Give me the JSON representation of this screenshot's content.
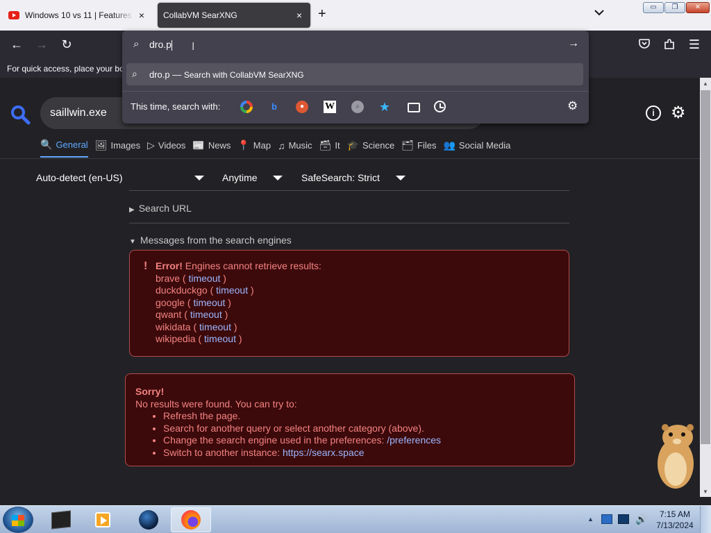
{
  "browser": {
    "tabs": [
      {
        "title": "Windows 10 vs 11 | Features & More",
        "active": false
      },
      {
        "title": "CollabVM SearXNG",
        "active": true
      }
    ],
    "new_tab_icon": "+",
    "tab_close_icon": "×",
    "tab_list_icon": "chevron-down-icon",
    "toolbar": {
      "back_icon": "←",
      "forward_icon": "→",
      "reload_icon": "↻",
      "pocket_icon": "pocket-icon",
      "extensions_icon": "puzzle-icon",
      "menu_icon": "☰"
    },
    "bookmarks_bar_text": "For quick access, place your bookmarks here on the bookmarks toolbar."
  },
  "urlbar": {
    "value": "dro.p",
    "suggestion": {
      "query": "dro.p",
      "separator": " — ",
      "description": "Search with CollabVM SearXNG"
    },
    "one_off_label": "This time, search with:",
    "engines": [
      "google-icon",
      "bing-icon",
      "duckduckgo-icon",
      "wikipedia-icon",
      "searx-icon",
      "bookmarks-star-icon",
      "tabs-icon",
      "history-icon"
    ],
    "wiki_glyph": "W",
    "settings_icon": "⚙",
    "go_icon": "→",
    "search_glyph": "⌕"
  },
  "page": {
    "query": "saillwin.exe",
    "info_icon": "i",
    "prefs_icon": "⚙",
    "categories": [
      {
        "label": "General",
        "icon": "🔍",
        "active": true
      },
      {
        "label": "Images",
        "icon": "🖼",
        "active": false
      },
      {
        "label": "Videos",
        "icon": "▷",
        "active": false
      },
      {
        "label": "News",
        "icon": "📰",
        "active": false
      },
      {
        "label": "Map",
        "icon": "📍",
        "active": false
      },
      {
        "label": "Music",
        "icon": "♫",
        "active": false
      },
      {
        "label": "It",
        "icon": "🗃",
        "active": false
      },
      {
        "label": "Science",
        "icon": "🎓",
        "active": false
      },
      {
        "label": "Files",
        "icon": "🗂",
        "active": false
      },
      {
        "label": "Social Media",
        "icon": "👥",
        "active": false
      }
    ],
    "filters": {
      "language": "Auto-detect (en-US)",
      "time": "Anytime",
      "safesearch": "SafeSearch: Strict"
    },
    "search_url_label": "Search URL",
    "messages_label": "Messages from the search engines",
    "error": {
      "bang": "!",
      "title": "Error!",
      "text": "Engines cannot retrieve results:",
      "engines": [
        {
          "name": "brave",
          "reason": "timeout"
        },
        {
          "name": "duckduckgo",
          "reason": "timeout"
        },
        {
          "name": "google",
          "reason": "timeout"
        },
        {
          "name": "qwant",
          "reason": "timeout"
        },
        {
          "name": "wikidata",
          "reason": "timeout"
        },
        {
          "name": "wikipedia",
          "reason": "timeout"
        }
      ]
    },
    "sorry": {
      "title": "Sorry!",
      "text": "No results were found. You can try to:",
      "items": [
        {
          "text": "Refresh the page.",
          "link": ""
        },
        {
          "text": "Search for another query or select another category (above).",
          "link": ""
        },
        {
          "text": "Change the search engine used in the preferences: ",
          "link": "/preferences"
        },
        {
          "text": "Switch to another instance: ",
          "link": "https://searx.space"
        }
      ]
    }
  },
  "taskbar": {
    "apps": [
      "terminal-icon",
      "media-player-icon",
      "globe-icon",
      "firefox-icon"
    ],
    "tray_arrow": "▲",
    "volume_icon": "🔊",
    "time": "7:15 AM",
    "date": "7/13/2024"
  },
  "colors": {
    "accent": "#5fa8ff",
    "error_bg": "#3c0a0b",
    "error_text": "#f58282",
    "link": "#9db6ff"
  }
}
